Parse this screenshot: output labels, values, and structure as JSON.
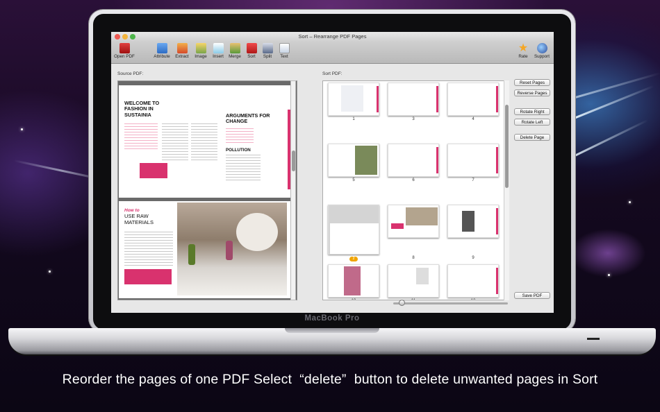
{
  "window": {
    "title": "Sort – Rearrange PDF Pages"
  },
  "toolbar": {
    "left": [
      {
        "label": "Open PDF",
        "icon": "open-pdf-icon"
      },
      {
        "label": "Attribute",
        "icon": "attribute-icon"
      },
      {
        "label": "Extract",
        "icon": "extract-icon"
      },
      {
        "label": "Image",
        "icon": "image-icon"
      },
      {
        "label": "Insert",
        "icon": "insert-icon"
      },
      {
        "label": "Merge",
        "icon": "merge-icon"
      },
      {
        "label": "Sort",
        "icon": "sort-icon"
      },
      {
        "label": "Split",
        "icon": "split-icon"
      },
      {
        "label": "Text",
        "icon": "text-icon"
      }
    ],
    "right": [
      {
        "label": "Rate",
        "icon": "star-icon"
      },
      {
        "label": "Support",
        "icon": "support-icon"
      }
    ]
  },
  "source": {
    "label": "Source PDF:",
    "page1": {
      "heading_left": "WELCOME TO FASHION IN SUSTAINIA",
      "heading_right": "ARGUMENTS FOR CHANGE",
      "subheading": "POLLUTION"
    },
    "page2": {
      "kicker": "How to",
      "heading": "USE RAW MATERIALS"
    }
  },
  "sort": {
    "label": "Sort PDF:",
    "pages": [
      "1",
      "3",
      "4",
      "5",
      "6",
      "7",
      "2",
      "8",
      "9",
      "10",
      "11",
      "12"
    ],
    "selected_badge": "2"
  },
  "buttons": {
    "reset": "Reset Pages",
    "reverse": "Reverse Pages",
    "rotate_right": "Rotate Right",
    "rotate_left": "Rotate Left",
    "delete": "Delete Page",
    "save": "Save PDF"
  },
  "device": {
    "brand": "MacBook Pro"
  },
  "caption": "Reorder the pages of one PDF Select  “delete”  button to delete unwanted pages in Sort",
  "colors": {
    "accent_pink": "#d9326e",
    "selected_badge": "#f0a400"
  }
}
